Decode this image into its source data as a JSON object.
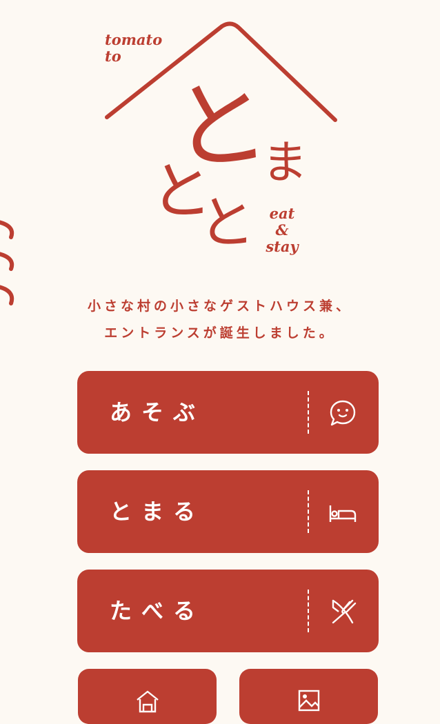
{
  "logo": {
    "tomato_to_line1": "tomato",
    "tomato_to_line2": "to",
    "kana_to_large": "と",
    "kana_ma": "ま",
    "kana_to_left": "と",
    "kana_to_bottom": "と",
    "eat": "eat",
    "amp": "&",
    "stay": "stay"
  },
  "tagline": {
    "line1": "小さな村の小さなゲストハウス兼、",
    "line2": "エントランスが誕生しました。"
  },
  "menu": [
    {
      "label": "あそぶ",
      "icon": "speech-bubble-smile-icon"
    },
    {
      "label": "とまる",
      "icon": "bed-icon"
    },
    {
      "label": "たべる",
      "icon": "fork-knife-icon"
    }
  ],
  "small_buttons": [
    {
      "icon": "house-icon"
    },
    {
      "icon": "picture-icon"
    }
  ],
  "colors": {
    "accent": "#bc3e31",
    "background": "#fdf9f3",
    "button_text": "#ffffff"
  }
}
